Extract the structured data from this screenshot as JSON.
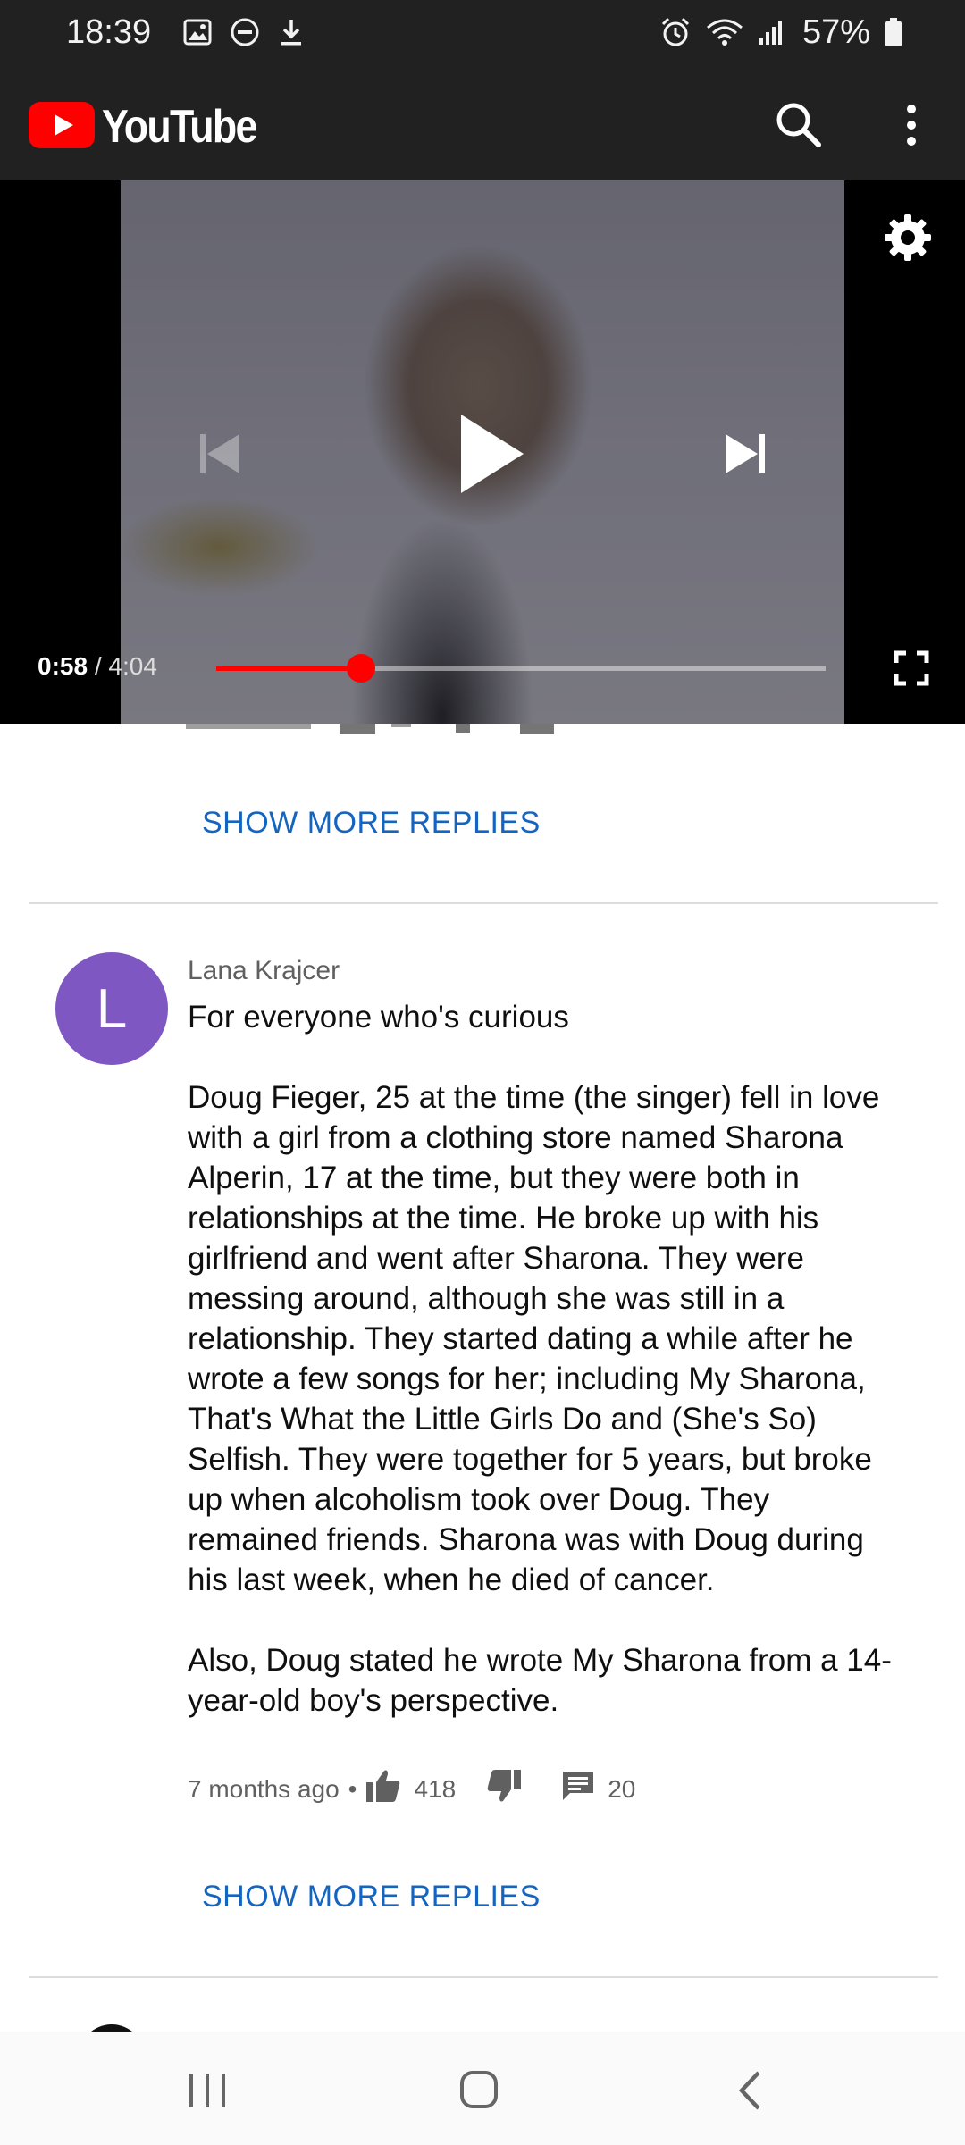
{
  "status_bar": {
    "time": "18:39",
    "battery": "57%",
    "icons": [
      "gallery-icon",
      "dnd-icon",
      "download-icon",
      "alarm-icon",
      "wifi-icon",
      "signal-icon",
      "battery-icon"
    ]
  },
  "app_bar": {
    "logo_text": "YouTube",
    "brand_color": "#ff0000"
  },
  "player": {
    "current_time": "0:58",
    "separator": "/",
    "duration": "4:04",
    "progress_fraction": 0.238
  },
  "replies_link_1": "SHOW MORE REPLIES",
  "comment": {
    "avatar_letter": "L",
    "avatar_color": "#7e57c2",
    "author": "Lana Krajcer",
    "text": "For everyone who's curious\n\nDoug Fieger, 25 at the time (the singer) fell in love with a girl from a clothing store named Sharona Alperin, 17 at the time, but they were both in relationships at the time. He broke up with his girlfriend and went after Sharona. They were messing around, although she was still in a relationship. They started dating a while after he wrote a few songs for her; including My Sharona, That's What the Little Girls Do and (She's So) Selfish. They were together for 5 years, but broke up when alcoholism took over Doug. They remained friends. Sharona was with Doug during his last week, when he died of cancer.\n\nAlso, Doug stated he wrote My Sharona from a 14-year-old boy's perspective.",
    "time_ago": "7 months ago",
    "dot": "•",
    "likes": "418",
    "replies": "20"
  },
  "replies_link_2": "SHOW MORE REPLIES",
  "link_color": "#1565c0"
}
